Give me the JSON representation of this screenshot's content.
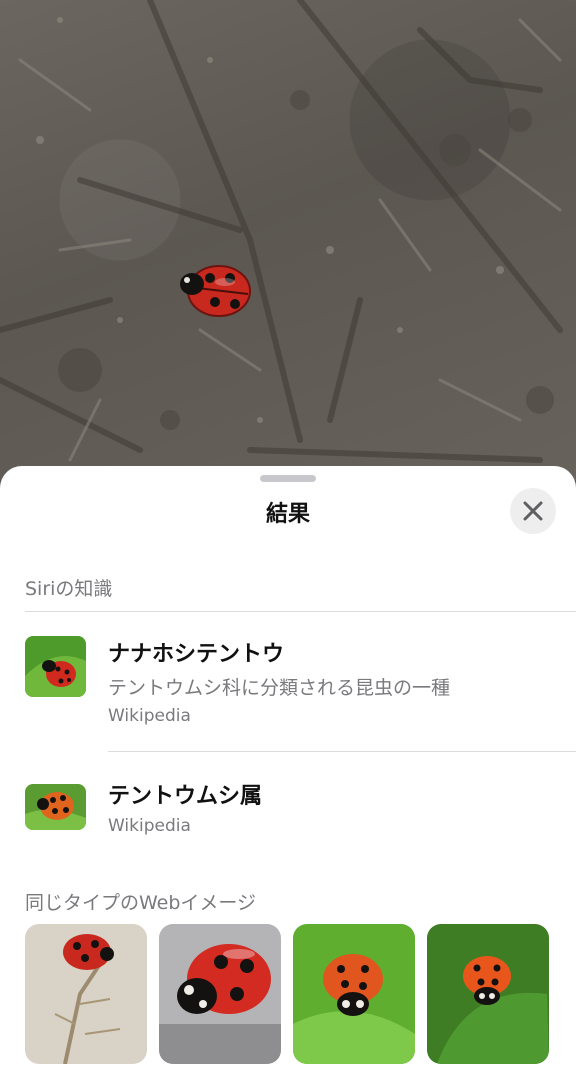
{
  "photo": {
    "subject_icon": "ladybug-icon"
  },
  "sheet": {
    "title": "結果",
    "close_icon": "close-icon"
  },
  "siri_section": {
    "label": "Siriの知識",
    "results": [
      {
        "title": "ナナホシテントウ",
        "description": "テントウムシ科に分類される昆虫の一種",
        "source": "Wikipedia"
      },
      {
        "title": "テントウムシ属",
        "source": "Wikipedia"
      }
    ]
  },
  "web_section": {
    "label": "同じタイプのWebイメージ",
    "image_count": 4
  },
  "colors": {
    "sheet_bg": "#ffffff",
    "secondary_text": "#7a7a7e",
    "ladybug_red": "#c8281e",
    "leaf_green": "#4e9a2a"
  }
}
